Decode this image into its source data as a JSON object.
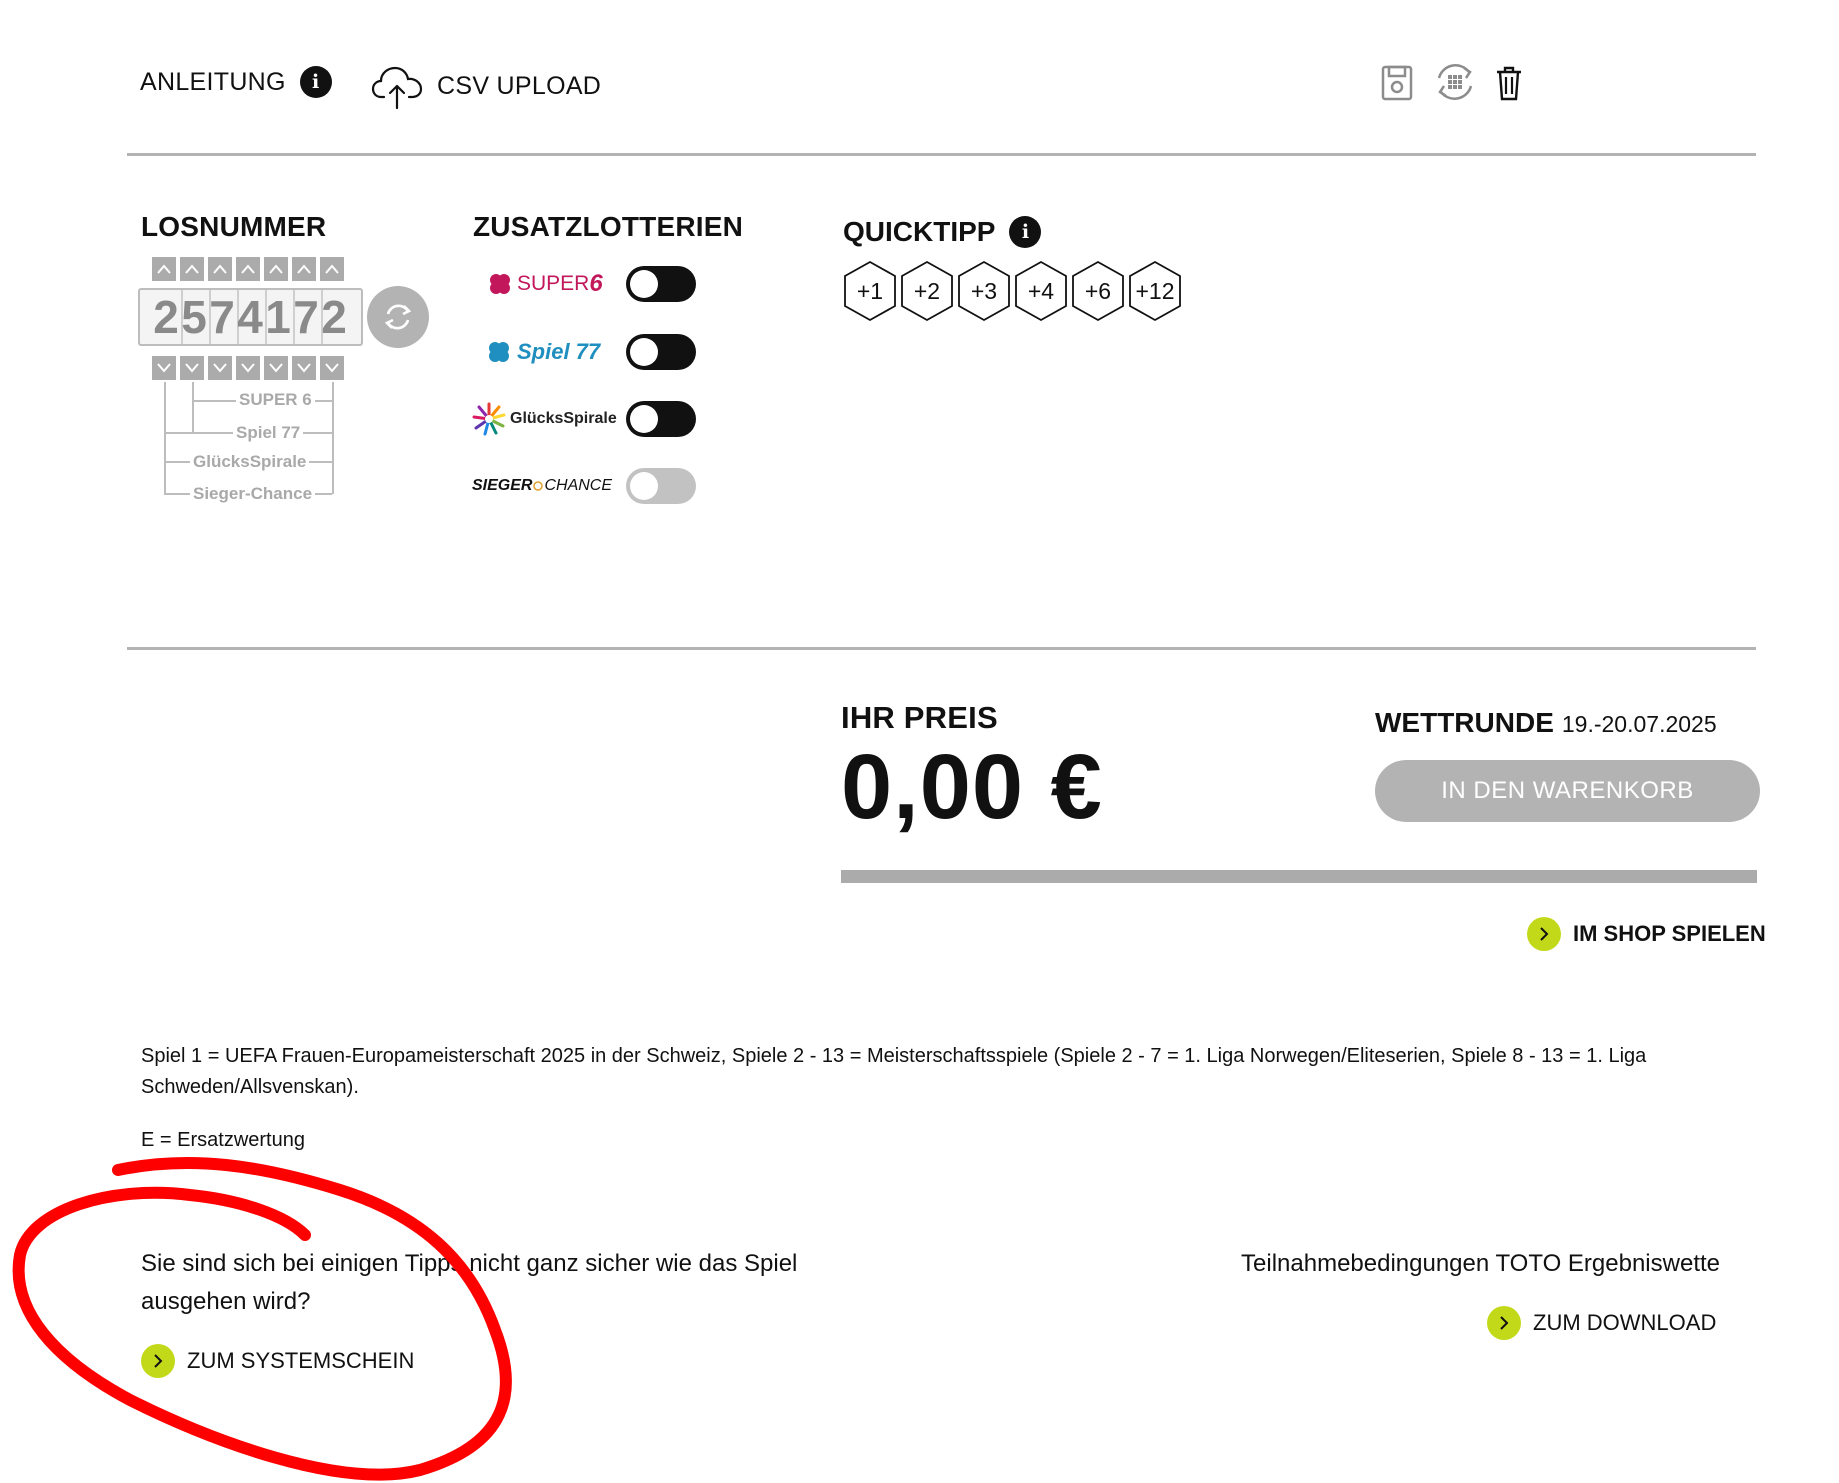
{
  "toolbar": {
    "instructions_label": "ANLEITUNG",
    "info_icon": "info-icon",
    "csv_label": "CSV UPLOAD",
    "csv_icon": "cloud-upload-icon",
    "tool_icons": [
      "save-icon",
      "sync-grid-icon",
      "trash-icon"
    ]
  },
  "losnummer": {
    "title": "LOSNUMMER",
    "digits": [
      "2",
      "5",
      "7",
      "4",
      "1",
      "7",
      "2"
    ],
    "labels": [
      "SUPER 6",
      "Spiel 77",
      "GlücksSpirale",
      "Sieger-Chance"
    ]
  },
  "zusatz": {
    "title": "ZUSATZLOTTERIEN",
    "items": [
      {
        "name": "SUPER",
        "suffix": "6",
        "on": true,
        "color": "#c2185b"
      },
      {
        "name": "Spiel",
        "suffix": "77",
        "on": true,
        "color": "#1f8fc0"
      },
      {
        "name": "GlücksSpirale",
        "suffix": "",
        "on": true,
        "color": "#222222"
      },
      {
        "name": "SIEGER",
        "suffix": "CHANCE",
        "on": false,
        "color": "#111111"
      }
    ]
  },
  "quicktipp": {
    "title": "QUICKTIPP",
    "options": [
      "+1",
      "+2",
      "+3",
      "+4",
      "+6",
      "+12"
    ]
  },
  "price": {
    "label": "IHR PREIS",
    "value": "0,00 €"
  },
  "round": {
    "label": "WETTRUNDE",
    "date": "19.-20.07.2025"
  },
  "cart_label": "IN DEN WARENKORB",
  "shop_label": "IM SHOP SPIELEN",
  "info_text": "Spiel 1 = UEFA Frauen-Europameisterschaft 2025 in der Schweiz, Spiele 2 - 13 = Meisterschaftsspiele (Spiele 2 - 7 = 1. Liga Norwegen/Eliteserien, Spiele 8 - 13 = 1. Liga Schweden/Allsvenskan).",
  "legend_text": "E = Ersatzwertung",
  "system": {
    "question": "Sie sind sich bei einigen Tipps nicht ganz sicher wie das Spiel ausgehen wird?",
    "link": "ZUM SYSTEMSCHEIN"
  },
  "terms": {
    "text": "Teilnahmebedingungen TOTO Ergebniswette",
    "link": "ZUM DOWNLOAD"
  },
  "colors": {
    "accent": "#c2d91a",
    "disabled": "#b3b3b3",
    "annotation": "#ff0000"
  }
}
